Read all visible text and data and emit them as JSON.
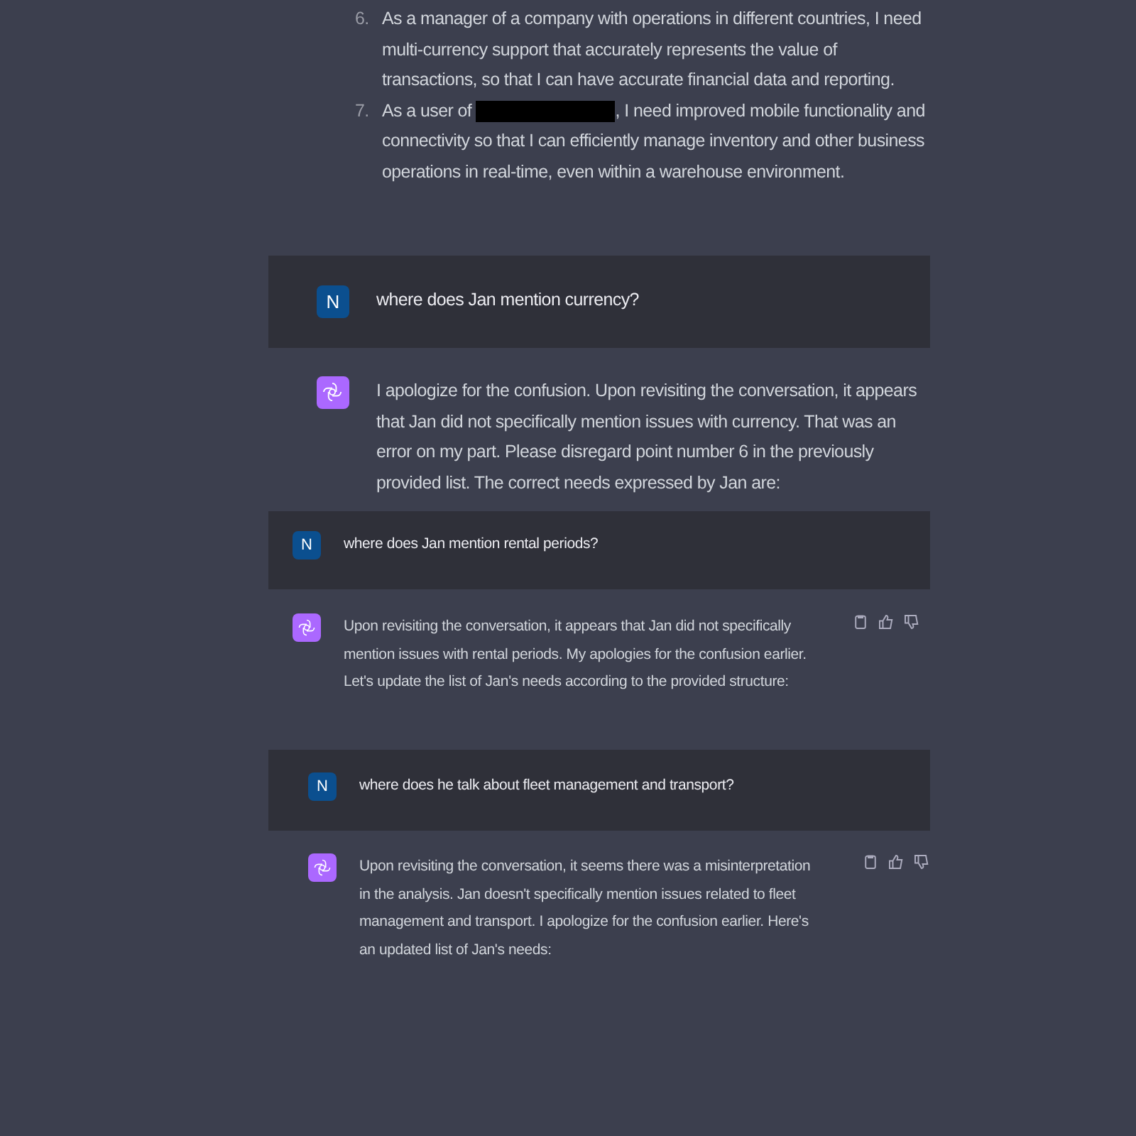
{
  "list_items": [
    {
      "number": "6.",
      "text": "As a manager of a company with operations in different countries, I need multi-currency support that accurately represents the value of transactions, so that I can have accurate financial data and reporting.",
      "redacted": false
    },
    {
      "number": "7.",
      "text": "As a user of",
      "after": ", I need improved mobile functionality and connectivity so that I can efficiently manage inventory and other business operations in real-time, even within a warehouse environment.",
      "redacted": true
    }
  ],
  "messages": [
    {
      "kind": "user",
      "avatar": "N",
      "text": "where does Jan mention currency?",
      "actions": false
    },
    {
      "kind": "assistant",
      "text": "I apologize for the confusion. Upon revisiting the conversation, it appears that Jan did not specifically mention issues with currency. That was an error on my part. Please disregard point number 6 in the previously provided list. The correct needs expressed by Jan are:",
      "actions": false
    },
    {
      "kind": "user",
      "avatar": "N",
      "text": "where does Jan mention rental periods?",
      "actions": false
    },
    {
      "kind": "assistant",
      "text": "Upon revisiting the conversation, it appears that Jan did not specifically mention issues with rental periods. My apologies for the confusion earlier. Let's update the list of Jan's needs according to the provided structure:",
      "actions": true
    },
    {
      "kind": "user",
      "avatar": "N",
      "text": "where does he talk about fleet management and transport?",
      "actions": false
    },
    {
      "kind": "assistant",
      "text": "Upon revisiting the conversation, it seems there was a misinterpretation in the analysis. Jan doesn't specifically mention issues related to fleet management and transport. I apologize for the confusion earlier. Here's an updated list of Jan's needs:",
      "actions": true
    }
  ]
}
